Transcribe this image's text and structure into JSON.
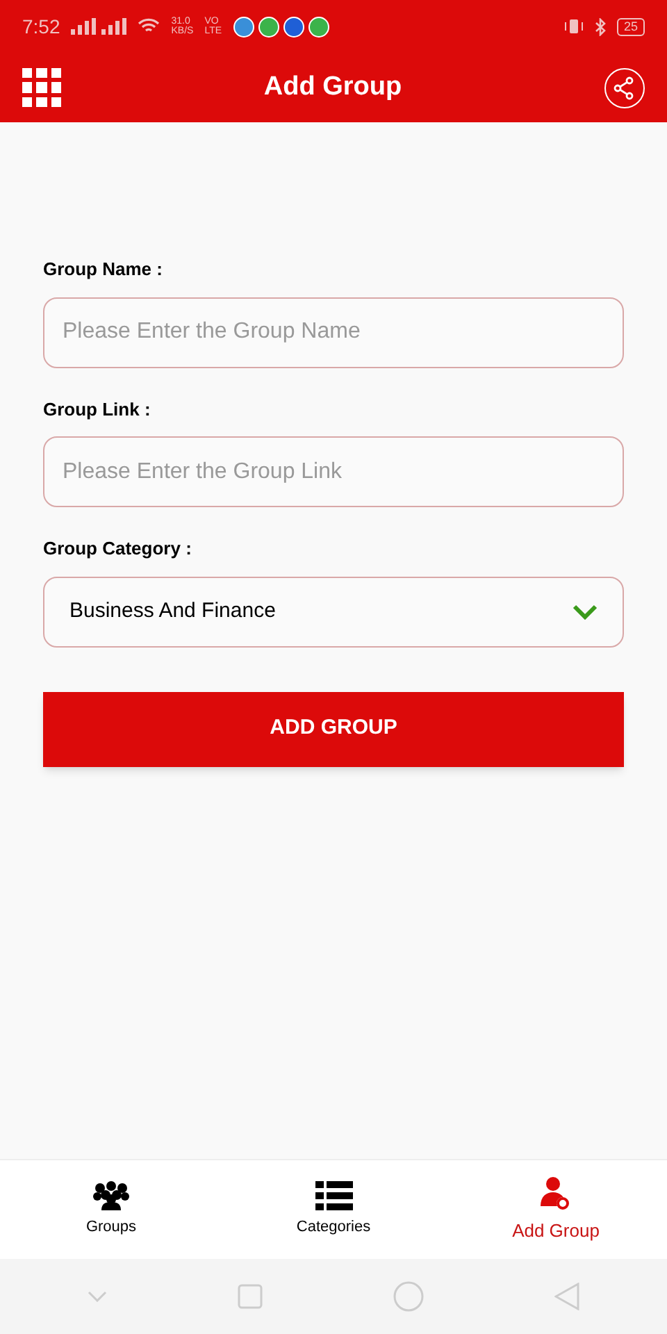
{
  "status_bar": {
    "time": "7:52",
    "speed": "31.0",
    "speed_unit": "KB/S",
    "volte": "VO",
    "lte": "LTE",
    "battery": "25"
  },
  "app_bar": {
    "title": "Add Group"
  },
  "form": {
    "fields": [
      {
        "kind": "text",
        "label": "Group Name :",
        "placeholder": "Please Enter the Group Name"
      },
      {
        "kind": "text",
        "label": "Group Link :",
        "placeholder": "Please Enter the Group Link"
      },
      {
        "kind": "select",
        "label": "Group Category :",
        "value": "Business And Finance"
      }
    ],
    "submit": "ADD GROUP"
  },
  "bottom_nav": [
    {
      "kind": "groups",
      "label": "Groups",
      "selected": false
    },
    {
      "kind": "categories",
      "label": "Categories",
      "selected": false
    },
    {
      "kind": "add",
      "label": "Add Group",
      "selected": true
    }
  ]
}
